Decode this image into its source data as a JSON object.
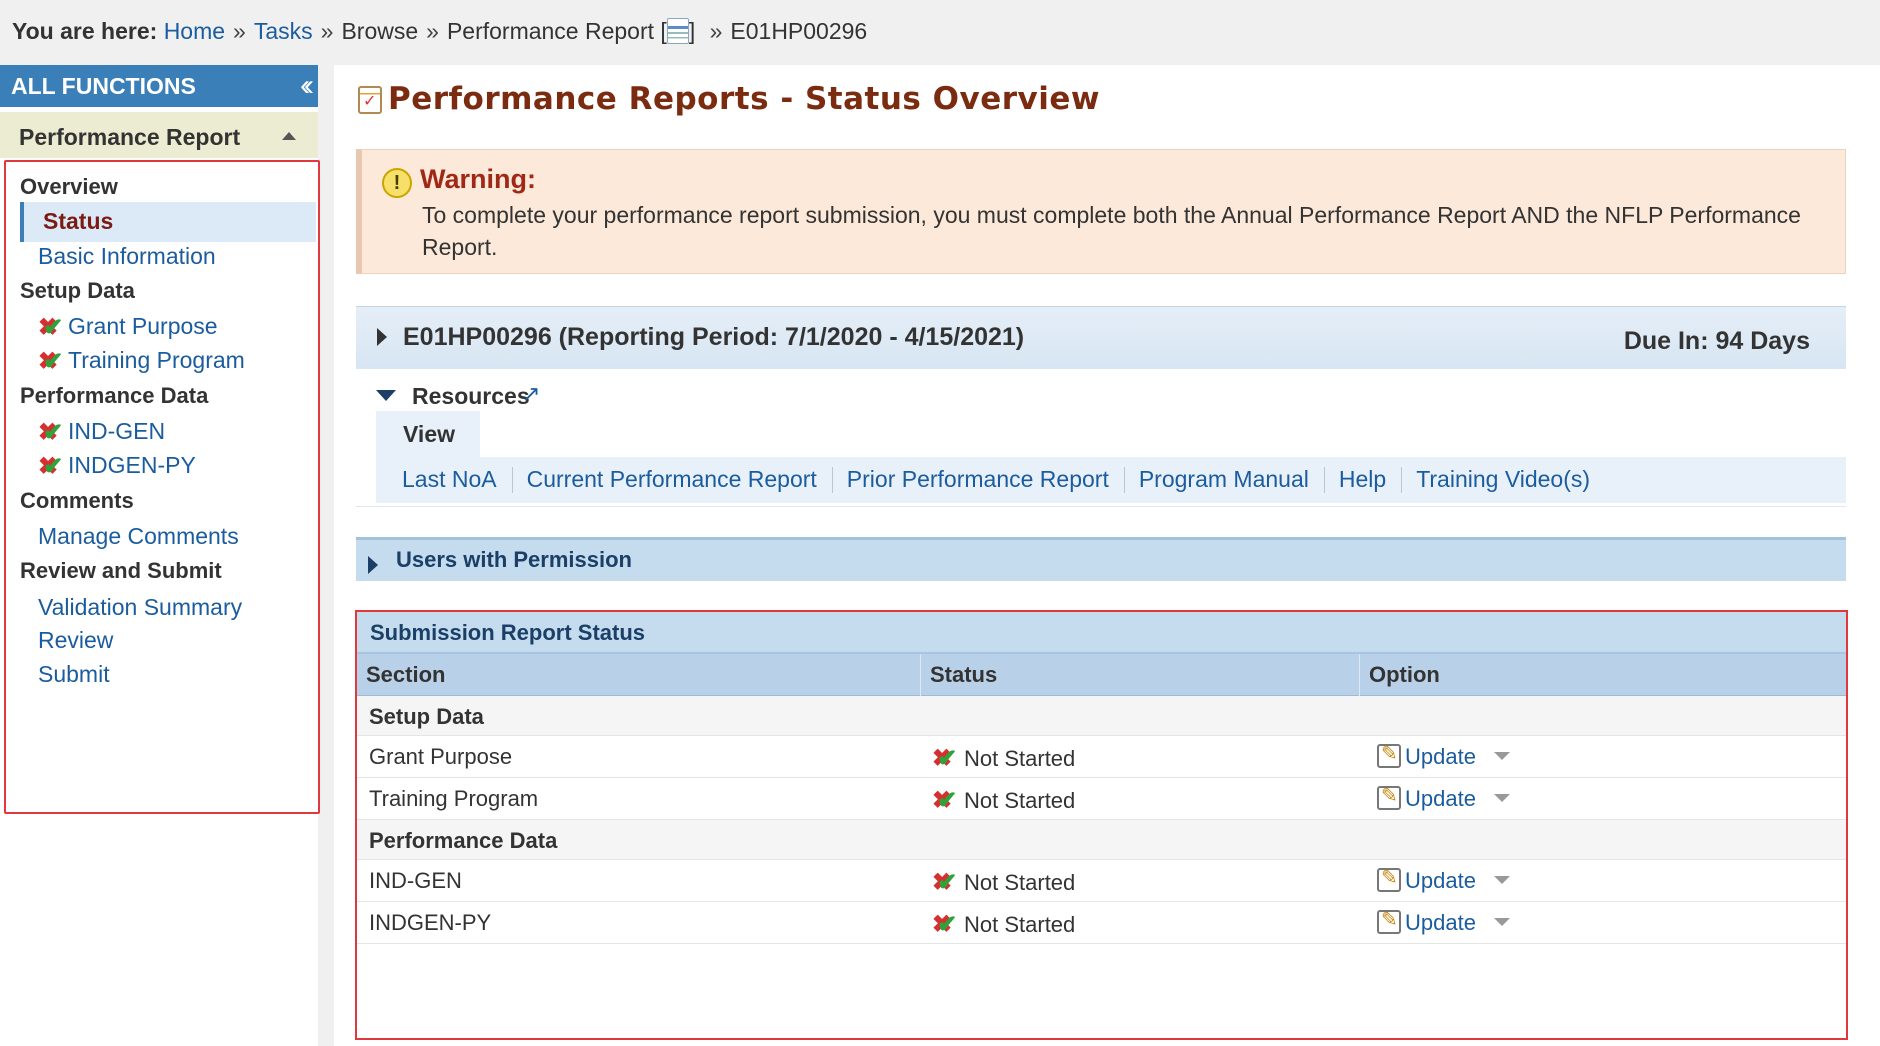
{
  "breadcrumb": {
    "prefix": "You are here:",
    "items": [
      "Home",
      "Tasks",
      "Browse",
      "Performance Report [",
      "] ",
      "E01HP00296"
    ],
    "separator": "»",
    "icon": "document-icon"
  },
  "sidebar": {
    "header": "ALL FUNCTIONS",
    "collapse_icon": "double-chevron-left-icon",
    "section_title": "Performance Report",
    "groups": [
      {
        "label": "Overview",
        "items": [
          {
            "label": "Status",
            "active": true
          },
          {
            "label": "Basic Information"
          }
        ]
      },
      {
        "label": "Setup Data",
        "items": [
          {
            "label": "Grant Purpose",
            "icon": "not-started-icon"
          },
          {
            "label": "Training Program",
            "icon": "not-started-icon"
          }
        ]
      },
      {
        "label": "Performance Data",
        "items": [
          {
            "label": "IND-GEN",
            "icon": "not-started-icon"
          },
          {
            "label": "INDGEN-PY",
            "icon": "not-started-icon"
          }
        ]
      },
      {
        "label": "Comments",
        "items": [
          {
            "label": "Manage Comments"
          }
        ]
      },
      {
        "label": "Review and Submit",
        "items": [
          {
            "label": "Validation Summary"
          },
          {
            "label": "Review"
          },
          {
            "label": "Submit"
          }
        ]
      }
    ]
  },
  "main": {
    "title": "Performance Reports - Status Overview",
    "warning": {
      "title": "Warning:",
      "text": "To complete your performance report submission, you must complete both the Annual Performance Report AND the NFLP Performance Report."
    },
    "report": {
      "title": "E01HP00296 (Reporting Period: 7/1/2020 - 4/15/2021)",
      "due": "Due In: 94 Days"
    },
    "resources": {
      "label": "Resources",
      "tab": "View",
      "links": [
        "Last NoA",
        "Current Performance Report",
        "Prior Performance Report",
        "Program Manual",
        "Help",
        "Training Video(s)"
      ]
    },
    "users_bar": "Users with Permission",
    "status_table": {
      "title": "Submission Report Status",
      "columns": [
        "Section",
        "Status",
        "Option"
      ],
      "groups": [
        {
          "label": "Setup Data",
          "rows": [
            {
              "section": "Grant Purpose",
              "status": "Not Started",
              "option": "Update"
            },
            {
              "section": "Training Program",
              "status": "Not Started",
              "option": "Update"
            }
          ]
        },
        {
          "label": "Performance Data",
          "rows": [
            {
              "section": "IND-GEN",
              "status": "Not Started",
              "option": "Update"
            },
            {
              "section": "INDGEN-PY",
              "status": "Not Started",
              "option": "Update"
            }
          ]
        }
      ]
    }
  },
  "colors": {
    "accent_blue": "#3b7fb8",
    "link": "#1b5c9e",
    "title": "#7a2b10",
    "warning_bg": "#fce9da",
    "highlight_border": "#e1383d"
  }
}
